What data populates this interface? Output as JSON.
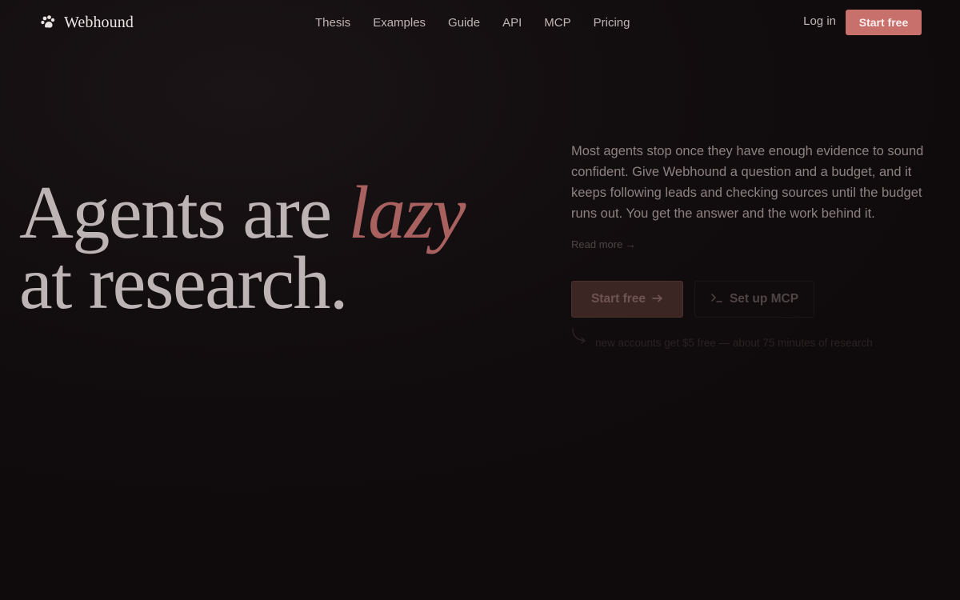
{
  "header": {
    "brand_name": "Webhound",
    "nav": [
      "Thesis",
      "Examples",
      "Guide",
      "API",
      "MCP",
      "Pricing"
    ],
    "login_label": "Log in",
    "cta_label": "Start free"
  },
  "hero": {
    "headline_prefix": "Agents are",
    "headline_accent": "lazy",
    "headline_suffix": "at research.",
    "lede": "Most agents stop once they have enough evidence to sound confident. Give Webhound a question and a budget, and it keeps following leads and checking sources until the budget runs out. You get the answer and the work behind it.",
    "read_more": "Read more →",
    "primary_label": "Start free",
    "secondary_label": "Set up MCP",
    "note": "new accounts get $5 free — about 75 minutes of research"
  },
  "icons": {
    "brand": "paw-logo-icon",
    "primary_arrow": "arrow-right-icon",
    "secondary": "terminal-icon",
    "note": "curved-arrow-icon"
  },
  "colors": {
    "background": "#0f0b0c",
    "accent": "#c8706b",
    "headline": "#bdb5b5",
    "headline_accent": "#a8615f"
  }
}
